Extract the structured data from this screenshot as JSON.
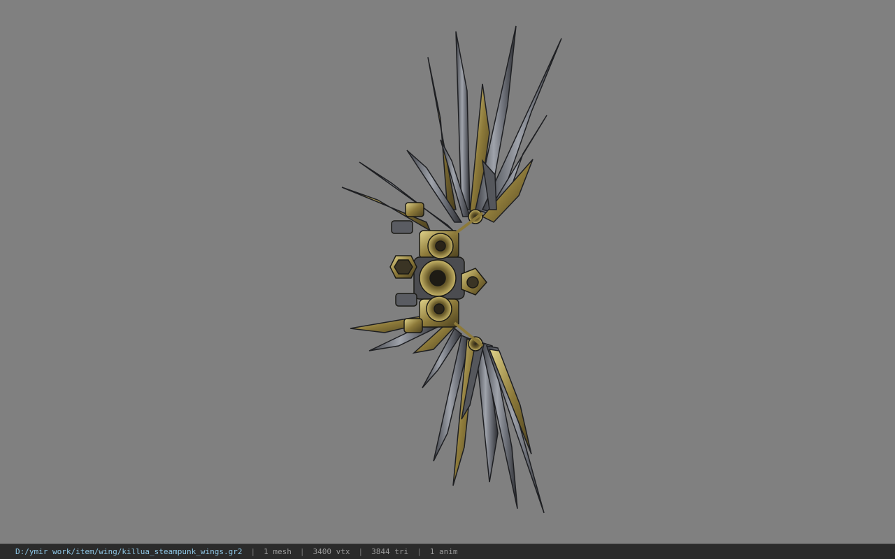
{
  "viewer": {
    "background_color": "#808080",
    "model_icon": "steampunk-wings-model"
  },
  "status": {
    "file_path": "D:/ymir work/item/wing/killua_steampunk_wings.gr2",
    "separator": "|",
    "mesh_count": "1 mesh",
    "vertex_count": "3400 vtx",
    "triangle_count": "3844 tri",
    "anim_count": "1 anim"
  }
}
